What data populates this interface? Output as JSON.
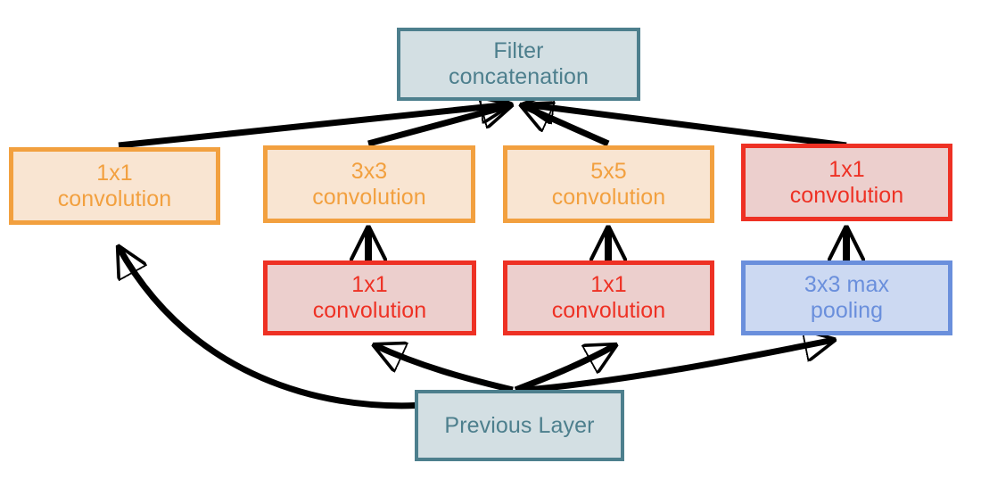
{
  "diagram": {
    "title": "Inception module naive/dimension-reduction block",
    "background": "#ffffff",
    "palette": {
      "teal_border": "#4d7f8d",
      "teal_fill": "#d3dfe3",
      "orange_border": "#f2a03f",
      "orange_fill": "#f9e5d2",
      "red_border": "#ee3124",
      "red_fill": "#eccfcd",
      "blue_border": "#6a8fdc",
      "blue_fill": "#ccd9f2",
      "arrow": "#000000"
    },
    "nodes": {
      "filter_concatenation": {
        "label": "Filter\nconcatenation",
        "style": "teal"
      },
      "conv1x1_left": {
        "label": "1x1\nconvolution",
        "style": "orange"
      },
      "conv3x3": {
        "label": "3x3\nconvolution",
        "style": "orange"
      },
      "conv5x5": {
        "label": "5x5\nconvolution",
        "style": "orange"
      },
      "conv1x1_right_top": {
        "label": "1x1\nconvolution",
        "style": "red"
      },
      "conv1x1_reduce_a": {
        "label": "1x1\nconvolution",
        "style": "red"
      },
      "conv1x1_reduce_b": {
        "label": "1x1\nconvolution",
        "style": "red"
      },
      "maxpool3x3": {
        "label": "3x3 max\npooling",
        "style": "blue"
      },
      "previous_layer": {
        "label": "Previous Layer",
        "style": "teal"
      }
    },
    "edges": [
      {
        "name": "previous-layer-to-conv1x1-left",
        "from": "previous_layer",
        "to": "conv1x1_left"
      },
      {
        "name": "previous-layer-to-conv1x1-reduce-a",
        "from": "previous_layer",
        "to": "conv1x1_reduce_a"
      },
      {
        "name": "previous-layer-to-conv1x1-reduce-b",
        "from": "previous_layer",
        "to": "conv1x1_reduce_b"
      },
      {
        "name": "previous-layer-to-maxpool3x3",
        "from": "previous_layer",
        "to": "maxpool3x3"
      },
      {
        "name": "conv1x1-reduce-a-to-conv3x3",
        "from": "conv1x1_reduce_a",
        "to": "conv3x3"
      },
      {
        "name": "conv1x1-reduce-b-to-conv5x5",
        "from": "conv1x1_reduce_b",
        "to": "conv5x5"
      },
      {
        "name": "maxpool3x3-to-conv1x1-right-top",
        "from": "maxpool3x3",
        "to": "conv1x1_right_top"
      },
      {
        "name": "conv1x1-left-to-filter-concatenation",
        "from": "conv1x1_left",
        "to": "filter_concatenation"
      },
      {
        "name": "conv3x3-to-filter-concatenation",
        "from": "conv3x3",
        "to": "filter_concatenation"
      },
      {
        "name": "conv5x5-to-filter-concatenation",
        "from": "conv5x5",
        "to": "filter_concatenation"
      },
      {
        "name": "conv1x1-right-top-to-filter-concatenation",
        "from": "conv1x1_right_top",
        "to": "filter_concatenation"
      }
    ]
  }
}
